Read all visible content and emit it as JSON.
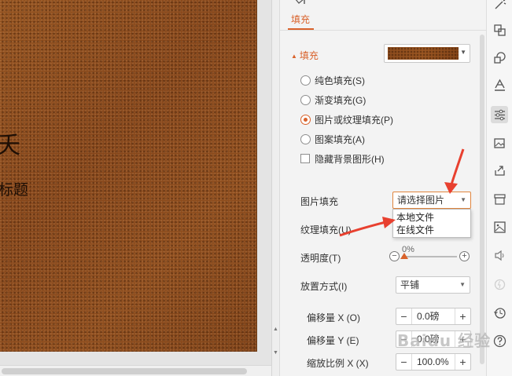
{
  "slide": {
    "title_fragment": "夭",
    "subtitle_fragment": "标题"
  },
  "pane": {
    "tab_fill": "填充",
    "section_fill": "填充",
    "fill_options": [
      {
        "label": "纯色填充(S)",
        "checked": false
      },
      {
        "label": "渐变填充(G)",
        "checked": false
      },
      {
        "label": "图片或纹理填充(P)",
        "checked": true
      },
      {
        "label": "图案填充(A)",
        "checked": false
      }
    ],
    "hide_bg_label": "隐藏背景图形(H)",
    "picture_fill_label": "图片填充",
    "picture_fill_value": "请选择图片",
    "picture_fill_menu": [
      "本地文件",
      "在线文件"
    ],
    "texture_fill_label": "纹理填充(U)",
    "transparency_label": "透明度(T)",
    "transparency_value": "0%",
    "placement_label": "放置方式(I)",
    "placement_value": "平铺",
    "offset_x_label": "偏移量 X (O)",
    "offset_x_value": "0.0磅",
    "offset_y_label": "偏移量 Y (E)",
    "offset_y_value": "0.0磅",
    "scale_x_label": "缩放比例 X (X)",
    "scale_x_value": "100.0%"
  },
  "rail": {
    "icons": [
      "magic-icon",
      "copy-shapes-icon",
      "shapes-icon",
      "text-style-icon",
      "properties-icon",
      "image-gallery-icon",
      "share-icon",
      "archive-icon",
      "picture-icon",
      "sound-icon",
      "disabled-icon",
      "history-icon",
      "help-icon"
    ],
    "active": "properties-icon"
  },
  "colors": {
    "accent": "#d9622b",
    "annotation": "#e8402f",
    "slide_bg": "#8a4a1e"
  },
  "watermark": "Baidu 经验"
}
